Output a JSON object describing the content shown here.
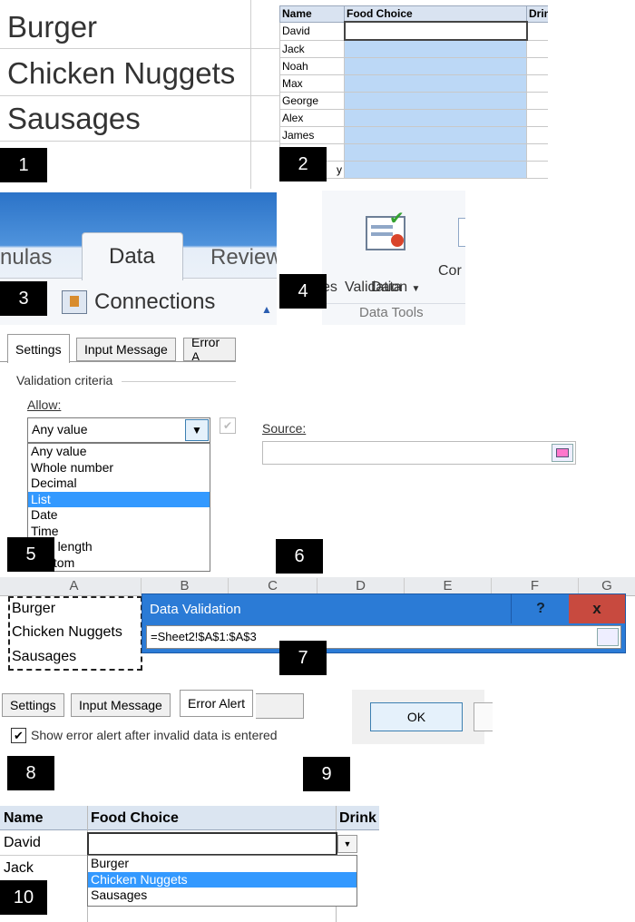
{
  "panel1": {
    "items": [
      "Burger",
      "Chicken Nuggets",
      "Sausages"
    ]
  },
  "panel2": {
    "headers": [
      "Name",
      "Food Choice",
      "Drin"
    ],
    "names": [
      "David",
      "Jack",
      "Noah",
      "Max",
      "George",
      "Alex",
      "James",
      "",
      "y"
    ]
  },
  "ribbon": {
    "tab_left": "nulas",
    "tab_active": "Data",
    "tab_right": "Review",
    "connections": "Connections"
  },
  "data_tools": {
    "btn_line1": "Data",
    "btn_line2": "Validation",
    "right_label": "Cor",
    "left_label": "es",
    "group": "Data Tools"
  },
  "dialog": {
    "tabs": [
      "Settings",
      "Input Message",
      "Error A"
    ],
    "criteria": "Validation criteria",
    "allow_label": "Allow:",
    "allow_value": "Any value",
    "options": [
      "Any value",
      "Whole number",
      "Decimal",
      "List",
      "Date",
      "Time",
      "Text length",
      "Custom"
    ],
    "selected_option": "List",
    "source_label": "Source:"
  },
  "sheet7": {
    "columns": [
      "A",
      "B",
      "C",
      "D",
      "E",
      "F",
      "G"
    ],
    "cells": [
      "Burger",
      "Chicken Nuggets",
      "Sausages"
    ],
    "popup_title": "Data Validation",
    "help": "?",
    "close": "x",
    "formula": "=Sheet2!$A$1:$A$3"
  },
  "error_alert": {
    "tabs": [
      "Settings",
      "Input Message",
      "Error Alert"
    ],
    "checkbox_label": "Show error alert after invalid data is entered"
  },
  "ok_button": "OK",
  "panel10": {
    "headers": [
      "Name",
      "Food Choice",
      "Drink"
    ],
    "rows": [
      "David",
      "Jack"
    ],
    "dropdown": [
      "Burger",
      "Chicken Nuggets",
      "Sausages"
    ],
    "selected": "Chicken Nuggets"
  },
  "badges": [
    "1",
    "2",
    "3",
    "4",
    "5",
    "6",
    "7",
    "8",
    "9",
    "10"
  ]
}
